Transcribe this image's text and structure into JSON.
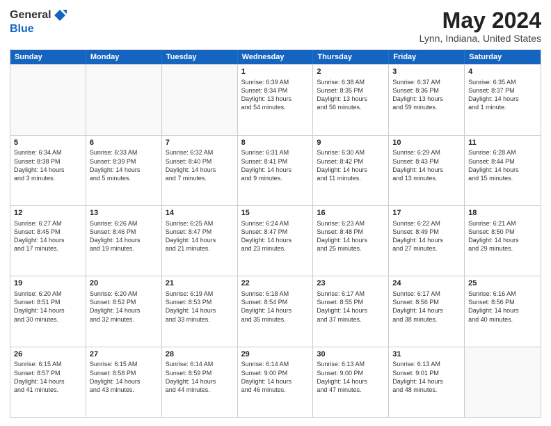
{
  "logo": {
    "general": "General",
    "blue": "Blue"
  },
  "title": {
    "month": "May 2024",
    "location": "Lynn, Indiana, United States"
  },
  "days_of_week": [
    "Sunday",
    "Monday",
    "Tuesday",
    "Wednesday",
    "Thursday",
    "Friday",
    "Saturday"
  ],
  "weeks": [
    [
      {
        "day": "",
        "info": []
      },
      {
        "day": "",
        "info": []
      },
      {
        "day": "",
        "info": []
      },
      {
        "day": "1",
        "info": [
          "Sunrise: 6:39 AM",
          "Sunset: 8:34 PM",
          "Daylight: 13 hours",
          "and 54 minutes."
        ]
      },
      {
        "day": "2",
        "info": [
          "Sunrise: 6:38 AM",
          "Sunset: 8:35 PM",
          "Daylight: 13 hours",
          "and 56 minutes."
        ]
      },
      {
        "day": "3",
        "info": [
          "Sunrise: 6:37 AM",
          "Sunset: 8:36 PM",
          "Daylight: 13 hours",
          "and 59 minutes."
        ]
      },
      {
        "day": "4",
        "info": [
          "Sunrise: 6:35 AM",
          "Sunset: 8:37 PM",
          "Daylight: 14 hours",
          "and 1 minute."
        ]
      }
    ],
    [
      {
        "day": "5",
        "info": [
          "Sunrise: 6:34 AM",
          "Sunset: 8:38 PM",
          "Daylight: 14 hours",
          "and 3 minutes."
        ]
      },
      {
        "day": "6",
        "info": [
          "Sunrise: 6:33 AM",
          "Sunset: 8:39 PM",
          "Daylight: 14 hours",
          "and 5 minutes."
        ]
      },
      {
        "day": "7",
        "info": [
          "Sunrise: 6:32 AM",
          "Sunset: 8:40 PM",
          "Daylight: 14 hours",
          "and 7 minutes."
        ]
      },
      {
        "day": "8",
        "info": [
          "Sunrise: 6:31 AM",
          "Sunset: 8:41 PM",
          "Daylight: 14 hours",
          "and 9 minutes."
        ]
      },
      {
        "day": "9",
        "info": [
          "Sunrise: 6:30 AM",
          "Sunset: 8:42 PM",
          "Daylight: 14 hours",
          "and 11 minutes."
        ]
      },
      {
        "day": "10",
        "info": [
          "Sunrise: 6:29 AM",
          "Sunset: 8:43 PM",
          "Daylight: 14 hours",
          "and 13 minutes."
        ]
      },
      {
        "day": "11",
        "info": [
          "Sunrise: 6:28 AM",
          "Sunset: 8:44 PM",
          "Daylight: 14 hours",
          "and 15 minutes."
        ]
      }
    ],
    [
      {
        "day": "12",
        "info": [
          "Sunrise: 6:27 AM",
          "Sunset: 8:45 PM",
          "Daylight: 14 hours",
          "and 17 minutes."
        ]
      },
      {
        "day": "13",
        "info": [
          "Sunrise: 6:26 AM",
          "Sunset: 8:46 PM",
          "Daylight: 14 hours",
          "and 19 minutes."
        ]
      },
      {
        "day": "14",
        "info": [
          "Sunrise: 6:25 AM",
          "Sunset: 8:47 PM",
          "Daylight: 14 hours",
          "and 21 minutes."
        ]
      },
      {
        "day": "15",
        "info": [
          "Sunrise: 6:24 AM",
          "Sunset: 8:47 PM",
          "Daylight: 14 hours",
          "and 23 minutes."
        ]
      },
      {
        "day": "16",
        "info": [
          "Sunrise: 6:23 AM",
          "Sunset: 8:48 PM",
          "Daylight: 14 hours",
          "and 25 minutes."
        ]
      },
      {
        "day": "17",
        "info": [
          "Sunrise: 6:22 AM",
          "Sunset: 8:49 PM",
          "Daylight: 14 hours",
          "and 27 minutes."
        ]
      },
      {
        "day": "18",
        "info": [
          "Sunrise: 6:21 AM",
          "Sunset: 8:50 PM",
          "Daylight: 14 hours",
          "and 29 minutes."
        ]
      }
    ],
    [
      {
        "day": "19",
        "info": [
          "Sunrise: 6:20 AM",
          "Sunset: 8:51 PM",
          "Daylight: 14 hours",
          "and 30 minutes."
        ]
      },
      {
        "day": "20",
        "info": [
          "Sunrise: 6:20 AM",
          "Sunset: 8:52 PM",
          "Daylight: 14 hours",
          "and 32 minutes."
        ]
      },
      {
        "day": "21",
        "info": [
          "Sunrise: 6:19 AM",
          "Sunset: 8:53 PM",
          "Daylight: 14 hours",
          "and 33 minutes."
        ]
      },
      {
        "day": "22",
        "info": [
          "Sunrise: 6:18 AM",
          "Sunset: 8:54 PM",
          "Daylight: 14 hours",
          "and 35 minutes."
        ]
      },
      {
        "day": "23",
        "info": [
          "Sunrise: 6:17 AM",
          "Sunset: 8:55 PM",
          "Daylight: 14 hours",
          "and 37 minutes."
        ]
      },
      {
        "day": "24",
        "info": [
          "Sunrise: 6:17 AM",
          "Sunset: 8:56 PM",
          "Daylight: 14 hours",
          "and 38 minutes."
        ]
      },
      {
        "day": "25",
        "info": [
          "Sunrise: 6:16 AM",
          "Sunset: 8:56 PM",
          "Daylight: 14 hours",
          "and 40 minutes."
        ]
      }
    ],
    [
      {
        "day": "26",
        "info": [
          "Sunrise: 6:15 AM",
          "Sunset: 8:57 PM",
          "Daylight: 14 hours",
          "and 41 minutes."
        ]
      },
      {
        "day": "27",
        "info": [
          "Sunrise: 6:15 AM",
          "Sunset: 8:58 PM",
          "Daylight: 14 hours",
          "and 43 minutes."
        ]
      },
      {
        "day": "28",
        "info": [
          "Sunrise: 6:14 AM",
          "Sunset: 8:59 PM",
          "Daylight: 14 hours",
          "and 44 minutes."
        ]
      },
      {
        "day": "29",
        "info": [
          "Sunrise: 6:14 AM",
          "Sunset: 9:00 PM",
          "Daylight: 14 hours",
          "and 46 minutes."
        ]
      },
      {
        "day": "30",
        "info": [
          "Sunrise: 6:13 AM",
          "Sunset: 9:00 PM",
          "Daylight: 14 hours",
          "and 47 minutes."
        ]
      },
      {
        "day": "31",
        "info": [
          "Sunrise: 6:13 AM",
          "Sunset: 9:01 PM",
          "Daylight: 14 hours",
          "and 48 minutes."
        ]
      },
      {
        "day": "",
        "info": []
      }
    ]
  ]
}
